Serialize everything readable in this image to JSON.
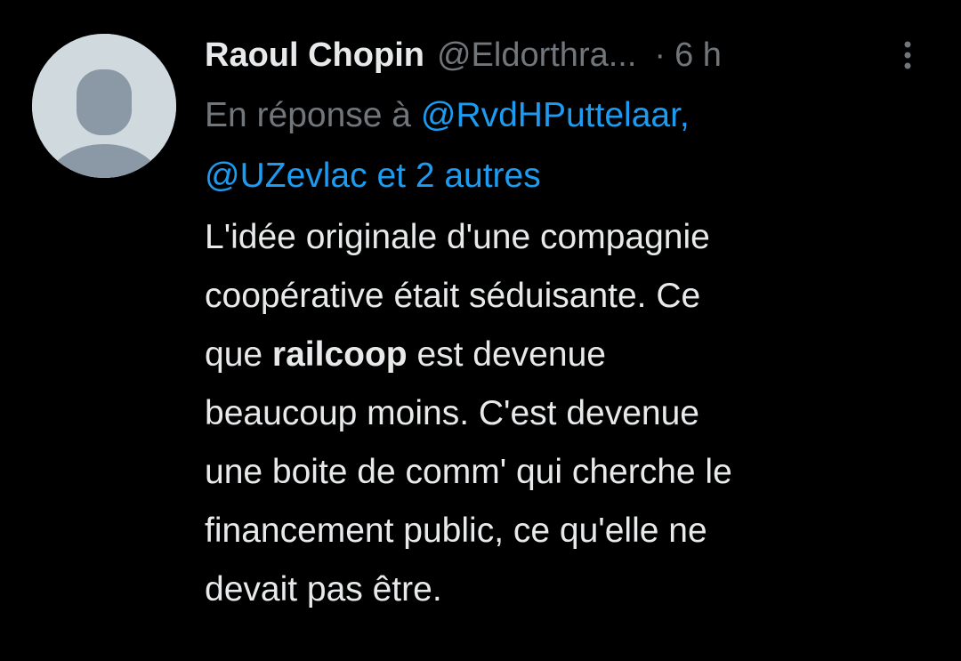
{
  "author": {
    "name": "Raoul Chopin",
    "handle": "@Eldorthra...",
    "separator": "·",
    "time": "6 h"
  },
  "reply_context": {
    "prefix": "En réponse à",
    "mention_1": "@RvdHPuttelaar,",
    "mention_2": "@UZevlac et 2 autres"
  },
  "tweet": {
    "line1": "L'idée originale d'une compagnie",
    "line2": "coopérative était séduisante. Ce",
    "line3_pre": "que ",
    "line3_bold": "railcoop",
    "line3_post": " est devenue",
    "line4": "beaucoup moins. C'est devenue",
    "line5": "une boite de comm' qui cherche le",
    "line6": "financement public, ce qu'elle ne",
    "line7": "devait pas être."
  },
  "icons": {
    "avatar": "default-profile-icon",
    "more": "more-vertical-icon"
  },
  "colors": {
    "background": "#000000",
    "primary_text": "#e7e9ea",
    "secondary_text": "#71767b",
    "link": "#1d9bf0",
    "avatar_bg": "#cfd9de",
    "avatar_fg": "#8b98a5"
  }
}
